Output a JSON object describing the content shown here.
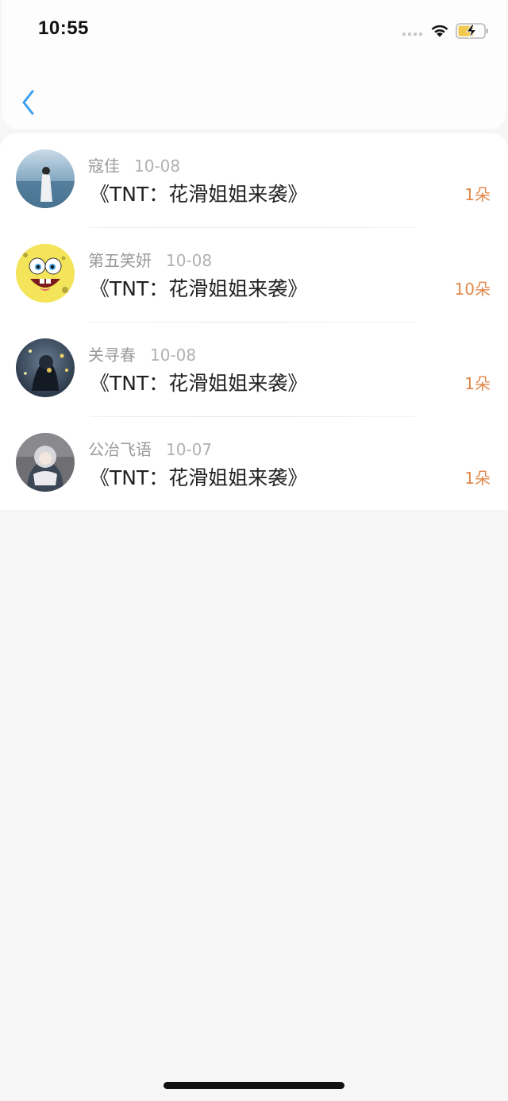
{
  "status_bar": {
    "time": "10:55"
  },
  "colors": {
    "accent": "#3a9ff0",
    "count": "#e0884a",
    "background": "#f6f6f6"
  },
  "nav": {
    "back_icon": "chevron-left-icon"
  },
  "list": [
    {
      "name": "寇佳",
      "date": "10-08",
      "title": "《TNT：花滑姐姐来袭》",
      "count": "1朵"
    },
    {
      "name": "第五笑妍",
      "date": "10-08",
      "title": "《TNT：花滑姐姐来袭》",
      "count": "10朵"
    },
    {
      "name": "关寻春",
      "date": "10-08",
      "title": "《TNT：花滑姐姐来袭》",
      "count": "1朵"
    },
    {
      "name": "公冶飞语",
      "date": "10-07",
      "title": "《TNT：花滑姐姐来袭》",
      "count": "1朵"
    }
  ]
}
